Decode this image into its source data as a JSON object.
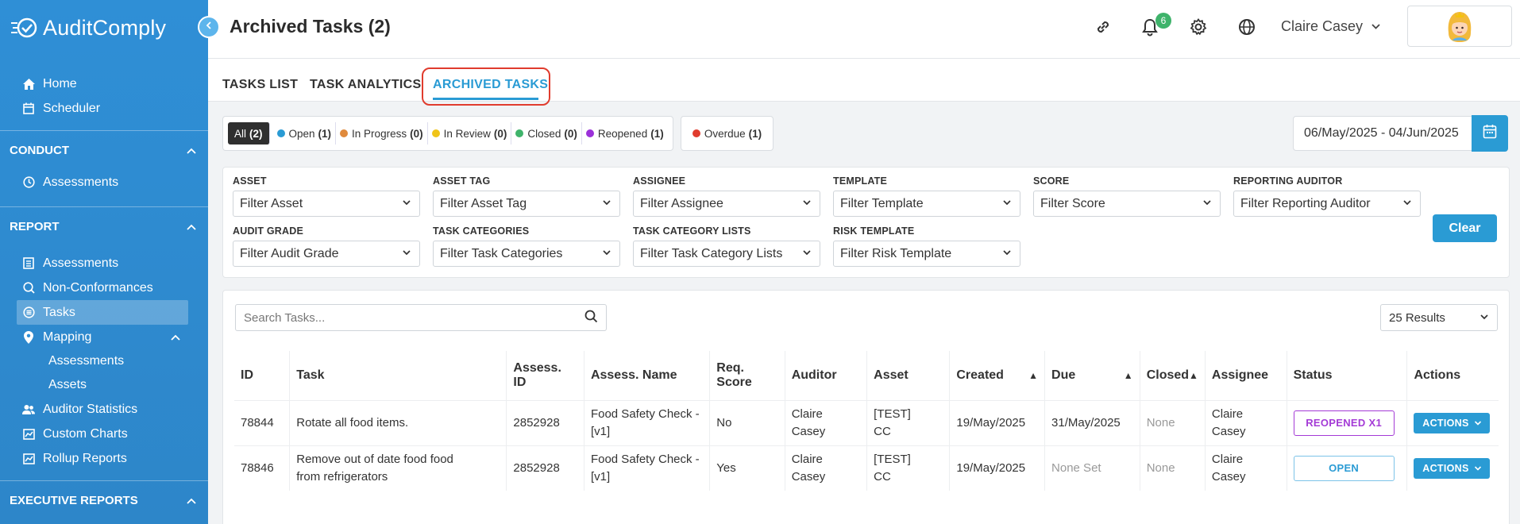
{
  "app": {
    "name": "AuditComply"
  },
  "sidebar": {
    "top_items": [
      {
        "label": "Home",
        "icon": "home-icon"
      },
      {
        "label": "Scheduler",
        "icon": "calendar-icon"
      }
    ],
    "conduct": {
      "title": "CONDUCT",
      "items": [
        {
          "label": "Assessments"
        }
      ]
    },
    "report": {
      "title": "REPORT",
      "items": [
        {
          "label": "Assessments"
        },
        {
          "label": "Non-Conformances"
        },
        {
          "label": "Tasks"
        },
        {
          "label": "Mapping"
        },
        {
          "label": "Assessments"
        },
        {
          "label": "Assets"
        },
        {
          "label": "Auditor Statistics"
        },
        {
          "label": "Custom Charts"
        },
        {
          "label": "Rollup Reports"
        }
      ]
    },
    "executive": {
      "title": "EXECUTIVE REPORTS"
    }
  },
  "header": {
    "title": "Archived Tasks (2)",
    "notification_count": "6",
    "user_name": "Claire Casey"
  },
  "tabs": [
    {
      "label": "TASKS LIST"
    },
    {
      "label": "TASK ANALYTICS"
    },
    {
      "label": "ARCHIVED TASKS"
    }
  ],
  "status_filters": [
    {
      "label": "All",
      "count": "(2)",
      "color": ""
    },
    {
      "label": "Open",
      "count": "(1)",
      "color": "#2a9bd4"
    },
    {
      "label": "In Progress",
      "count": "(0)",
      "color": "#e08a3c"
    },
    {
      "label": "In Review",
      "count": "(0)",
      "color": "#f0c419"
    },
    {
      "label": "Closed",
      "count": "(0)",
      "color": "#3fb36b"
    },
    {
      "label": "Reopened",
      "count": "(1)",
      "color": "#9b30d9"
    }
  ],
  "overdue": {
    "label": "Overdue",
    "count": "(1)",
    "color": "#e03c2e"
  },
  "date_range": "06/May/2025 - 04/Jun/2025",
  "filters": [
    {
      "label": "ASSET",
      "value": "Filter Asset"
    },
    {
      "label": "ASSET TAG",
      "value": "Filter Asset Tag"
    },
    {
      "label": "ASSIGNEE",
      "value": "Filter Assignee"
    },
    {
      "label": "TEMPLATE",
      "value": "Filter Template"
    },
    {
      "label": "SCORE",
      "value": "Filter Score"
    },
    {
      "label": "REPORTING AUDITOR",
      "value": "Filter Reporting Auditor"
    },
    {
      "label": "AUDIT GRADE",
      "value": "Filter Audit Grade"
    },
    {
      "label": "TASK CATEGORIES",
      "value": "Filter Task Categories"
    },
    {
      "label": "TASK CATEGORY LISTS",
      "value": "Filter Task Category Lists"
    },
    {
      "label": "RISK TEMPLATE",
      "value": "Filter Risk Template"
    }
  ],
  "clear_label": "Clear",
  "search": {
    "placeholder": "Search Tasks..."
  },
  "results_label": "25 Results",
  "table": {
    "headers": [
      "ID",
      "Task",
      "Assess. ID",
      "Assess. Name",
      "Req. Score",
      "Auditor",
      "Asset",
      "Created",
      "Due",
      "Closed",
      "Assignee",
      "Status",
      "Actions"
    ],
    "rows": [
      {
        "id": "78844",
        "task": "Rotate all food items.",
        "assess_id": "2852928",
        "assess_name": "Food Safety Check - [v1]",
        "req_score": "No",
        "auditor": "Claire Casey",
        "asset": "[TEST] CC",
        "created": "19/May/2025",
        "due": "31/May/2025",
        "closed": "None",
        "assignee": "Claire Casey",
        "status": "REOPENED X1",
        "action": "ACTIONS"
      },
      {
        "id": "78846",
        "task": "Remove out of date food food from refrigerators",
        "assess_id": "2852928",
        "assess_name": "Food Safety Check - [v1]",
        "req_score": "Yes",
        "auditor": "Claire Casey",
        "asset": "[TEST] CC",
        "created": "19/May/2025",
        "due": "None Set",
        "closed": "None",
        "assignee": "Claire Casey",
        "status": "OPEN",
        "action": "ACTIONS"
      }
    ]
  },
  "colors": {
    "sidebar": "#2f8fd6",
    "accent": "#2a9bd4",
    "reopened": "#a43bd6",
    "highlight": "#e03c2e"
  }
}
